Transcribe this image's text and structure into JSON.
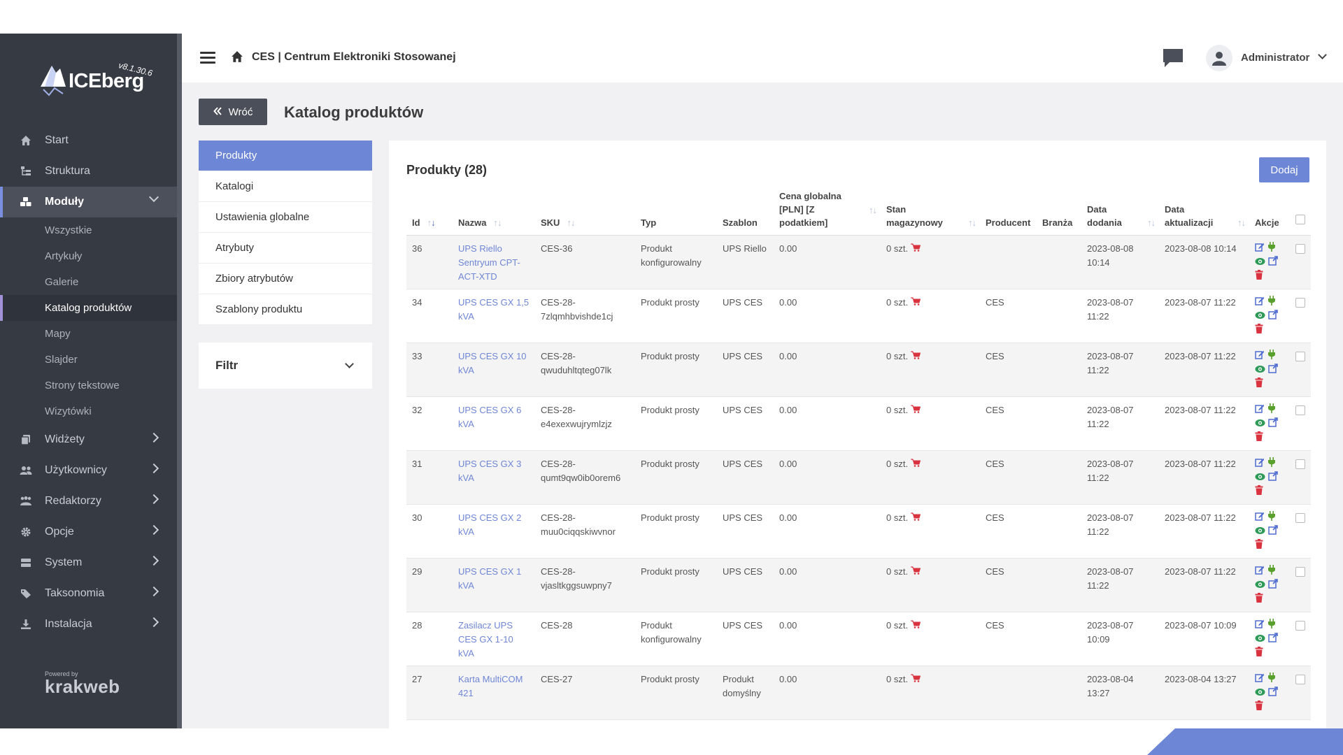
{
  "app": {
    "logo_name": "ICEberg",
    "logo_version": "v8.1.30.6",
    "powered_by": "Powered by",
    "powered_brand": "krakweb"
  },
  "sidebar": {
    "items": [
      {
        "label": "Start",
        "icon": "home-icon"
      },
      {
        "label": "Struktura",
        "icon": "sitemap-icon"
      },
      {
        "label": "Moduły",
        "icon": "cubes-icon"
      }
    ],
    "submenu": [
      "Wszystkie",
      "Artykuły",
      "Galerie",
      "Katalog produktów",
      "Mapy",
      "Slajder",
      "Strony tekstowe",
      "Wizytówki"
    ],
    "items_after": [
      {
        "label": "Widżety",
        "icon": "copy-icon"
      },
      {
        "label": "Użytkownicy",
        "icon": "users-icon"
      },
      {
        "label": "Redaktorzy",
        "icon": "editors-icon"
      },
      {
        "label": "Opcje",
        "icon": "gear-icon"
      },
      {
        "label": "System",
        "icon": "server-icon"
      },
      {
        "label": "Taksonomia",
        "icon": "tags-icon"
      },
      {
        "label": "Instalacja",
        "icon": "download-icon"
      }
    ]
  },
  "topbar": {
    "company": "CES | Centrum Elektroniki Stosowanej",
    "user": "Administrator"
  },
  "page": {
    "back_label": "Wróć",
    "title": "Katalog produktów"
  },
  "side_menu": [
    "Produkty",
    "Katalogi",
    "Ustawienia globalne",
    "Atrybuty",
    "Zbiory atrybutów",
    "Szablony produktu"
  ],
  "filter": {
    "label": "Filtr"
  },
  "products": {
    "title": "Produkty (28)",
    "add_label": "Dodaj",
    "columns": {
      "id": "Id",
      "name": "Nazwa",
      "sku": "SKU",
      "type": "Typ",
      "template": "Szablon",
      "price_1": "Cena globalna",
      "price_2": "[PLN] [Z",
      "price_3": "podatkiem]",
      "stock_1": "Stan",
      "stock_2": "magazynowy",
      "producer": "Producent",
      "industry": "Branża",
      "added_1": "Data",
      "added_2": "dodania",
      "updated_1": "Data",
      "updated_2": "aktualizacji",
      "actions": "Akcje"
    },
    "rows": [
      {
        "id": "36",
        "name": "UPS Riello Sentryum CPT-ACT-XTD",
        "sku": "CES-36",
        "type": "Produkt konfigurowalny",
        "template": "UPS Riello",
        "price": "0.00",
        "stock": "0 szt.",
        "producer": "",
        "industry": "",
        "added": "2023-08-08 10:14",
        "updated": "2023-08-08 10:14"
      },
      {
        "id": "34",
        "name": "UPS CES GX 1,5 kVA",
        "sku": "CES-28-7zlqmhbvishde1cj",
        "type": "Produkt prosty",
        "template": "UPS CES",
        "price": "0.00",
        "stock": "0 szt.",
        "producer": "CES",
        "industry": "",
        "added": "2023-08-07 11:22",
        "updated": "2023-08-07 11:22"
      },
      {
        "id": "33",
        "name": "UPS CES GX 10 kVA",
        "sku": "CES-28-qwuduhltqteg07lk",
        "type": "Produkt prosty",
        "template": "UPS CES",
        "price": "0.00",
        "stock": "0 szt.",
        "producer": "CES",
        "industry": "",
        "added": "2023-08-07 11:22",
        "updated": "2023-08-07 11:22"
      },
      {
        "id": "32",
        "name": "UPS CES GX 6 kVA",
        "sku": "CES-28-e4exexwujrymlzjz",
        "type": "Produkt prosty",
        "template": "UPS CES",
        "price": "0.00",
        "stock": "0 szt.",
        "producer": "CES",
        "industry": "",
        "added": "2023-08-07 11:22",
        "updated": "2023-08-07 11:22"
      },
      {
        "id": "31",
        "name": "UPS CES GX 3 kVA",
        "sku": "CES-28-qumt9qw0ib0orem6",
        "type": "Produkt prosty",
        "template": "UPS CES",
        "price": "0.00",
        "stock": "0 szt.",
        "producer": "CES",
        "industry": "",
        "added": "2023-08-07 11:22",
        "updated": "2023-08-07 11:22"
      },
      {
        "id": "30",
        "name": "UPS CES GX 2 kVA",
        "sku": "CES-28-muu0ciqqskiwvnor",
        "type": "Produkt prosty",
        "template": "UPS CES",
        "price": "0.00",
        "stock": "0 szt.",
        "producer": "CES",
        "industry": "",
        "added": "2023-08-07 11:22",
        "updated": "2023-08-07 11:22"
      },
      {
        "id": "29",
        "name": "UPS CES GX 1 kVA",
        "sku": "CES-28-vjasltkggsuwpny7",
        "type": "Produkt prosty",
        "template": "UPS CES",
        "price": "0.00",
        "stock": "0 szt.",
        "producer": "CES",
        "industry": "",
        "added": "2023-08-07 11:22",
        "updated": "2023-08-07 11:22"
      },
      {
        "id": "28",
        "name": "Zasilacz UPS CES GX 1-10 kVA",
        "sku": "CES-28",
        "type": "Produkt konfigurowalny",
        "template": "UPS CES",
        "price": "0.00",
        "stock": "0 szt.",
        "producer": "CES",
        "industry": "",
        "added": "2023-08-07 10:09",
        "updated": "2023-08-07 10:09"
      },
      {
        "id": "27",
        "name": "Karta MultiCOM 421",
        "sku": "CES-27",
        "type": "Produkt prosty",
        "template": "Produkt domyślny",
        "price": "0.00",
        "stock": "0 szt.",
        "producer": "",
        "industry": "",
        "added": "2023-08-04 13:27",
        "updated": "2023-08-04 13:27"
      }
    ]
  },
  "colors": {
    "sidebar_bg": "#363a43",
    "accent": "#6e86d6",
    "link": "#6f86d6",
    "cart": "#d9333f",
    "edit": "#4e6bd0",
    "plug": "#5aa02c",
    "view": "#2e9a57",
    "delete": "#d9333f"
  }
}
